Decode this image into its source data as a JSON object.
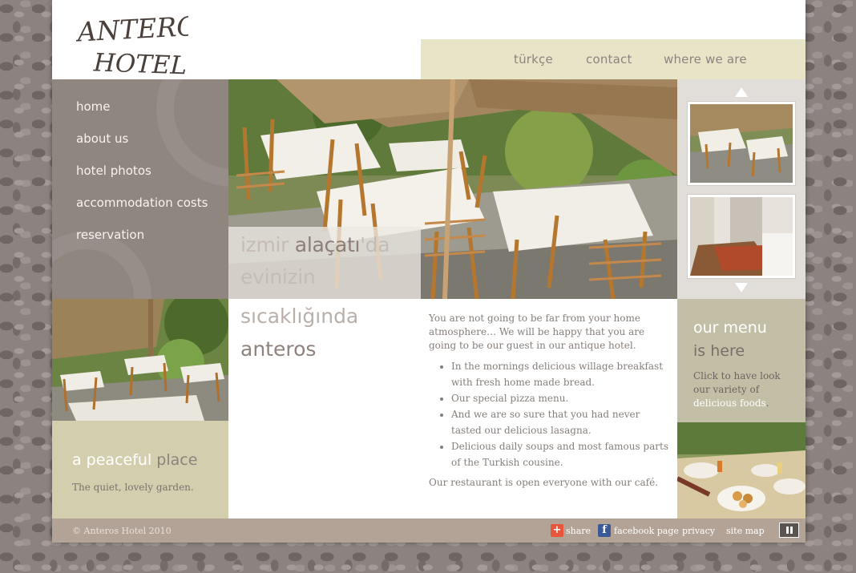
{
  "logo": {
    "line1": "ANTEROS",
    "line2": "HOTEL"
  },
  "top_nav": [
    "türkçe",
    "contact",
    "where we are"
  ],
  "side_nav": [
    "home",
    "about us",
    "hotel photos",
    "accommodation costs",
    "reservation"
  ],
  "tagline": {
    "line1_a": "izmir ",
    "line1_b": "alaçatı",
    "line1_c": "'da",
    "line2": "evinizin",
    "line3": "sıcaklığında",
    "line4": "anteros"
  },
  "content": {
    "intro": "You are not going to be far from your home atmosphere… We will be happy that you are going to be our guest in our antique hotel.",
    "bullets": [
      "In the mornings delicious willage breakfast with fresh home made bread.",
      "Our special pizza menu.",
      "And we are so sure that you had never tasted our delicious lasagna.",
      "Delicious daily soups and most famous parts of the Turkish cousine."
    ],
    "outro": "Our restaurant is open everyone with our café."
  },
  "peaceful": {
    "title_light": "a peaceful ",
    "title_dark": "place",
    "text": "The quiet, lovely garden."
  },
  "menu_box": {
    "title_line1": "our menu",
    "title_line2": "is here",
    "text_a": "Click to have look our variety of ",
    "text_link": "delicious foods",
    "text_b": "."
  },
  "footer": {
    "copyright": "© Anteros Hotel 2010",
    "share": "share",
    "facebook": "facebook page",
    "privacy": "privacy",
    "sitemap": "site map"
  },
  "colors": {
    "top_nav_bg": "#e8e4c8",
    "side_nav_bg": "#908680",
    "footer_bg": "#b3a396",
    "accent_olive": "#d3ceae"
  },
  "icons": {
    "share": "plus-icon",
    "facebook": "facebook-icon",
    "pause": "pause-icon",
    "up": "arrow-up-icon",
    "down": "arrow-down-icon"
  }
}
